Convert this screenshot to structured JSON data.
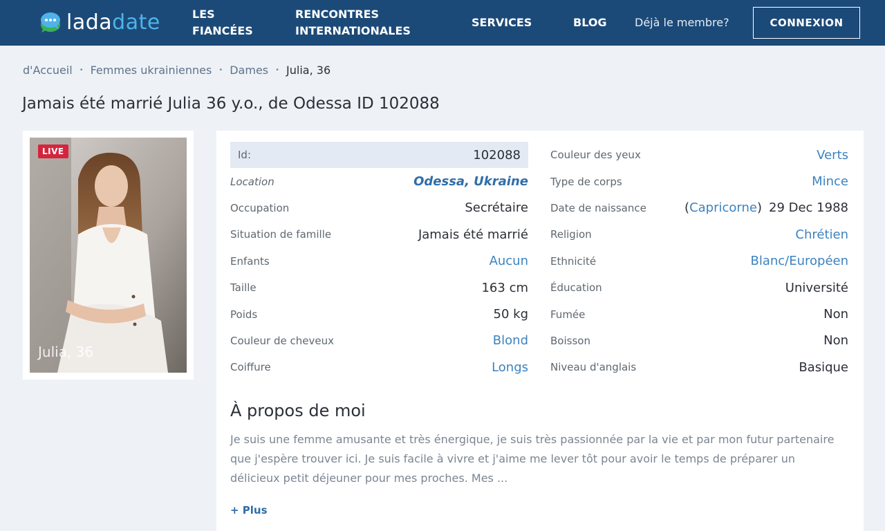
{
  "header": {
    "logo_part1": "lada",
    "logo_part2": "date",
    "nav": [
      {
        "line1": "LES",
        "line2": "FIANCÉES"
      },
      {
        "line1": "RENCONTRES",
        "line2": "INTERNATIONALES"
      },
      {
        "label": "SERVICES"
      },
      {
        "label": "BLOG"
      }
    ],
    "member_text": "Déjà le membre?",
    "connexion_label": "CONNEXION"
  },
  "breadcrumb": {
    "items": [
      "d'Accueil",
      "Femmes ukrainiennes",
      "Dames"
    ],
    "current": "Julia, 36",
    "separator": "•"
  },
  "page_title": "Jamais été marrié Julia 36 y.o., de Odessa ID 102088",
  "photo": {
    "badge": "LIVE",
    "caption": "Julia, 36"
  },
  "details_left": [
    {
      "label": "Id:",
      "value": "102088"
    },
    {
      "label": "Location",
      "value": "Odessa, Ukraine"
    },
    {
      "label": "Occupation",
      "value": "Secrétaire"
    },
    {
      "label": "Situation de famille",
      "value": "Jamais été marrié"
    },
    {
      "label": "Enfants",
      "value": "Aucun"
    },
    {
      "label": "Taille",
      "value": "163 cm"
    },
    {
      "label": "Poids",
      "value": "50 kg"
    },
    {
      "label": "Couleur de cheveux",
      "value": "Blond"
    },
    {
      "label": "Coiffure",
      "value": "Longs"
    }
  ],
  "details_right": [
    {
      "label": "Couleur des yeux",
      "value": "Verts"
    },
    {
      "label": "Type de corps",
      "value": "Mince"
    },
    {
      "label": "Date de naissance",
      "zodiac": "Capricorne",
      "paren_open": "(",
      "paren_close": ")",
      "value": "29 Dec 1988"
    },
    {
      "label": "Religion",
      "value": "Chrétien"
    },
    {
      "label": "Ethnicité",
      "value": "Blanc/Européen"
    },
    {
      "label": "Éducation",
      "value": "Université"
    },
    {
      "label": "Fumée",
      "value": "Non"
    },
    {
      "label": "Boisson",
      "value": "Non"
    },
    {
      "label": "Niveau d'anglais",
      "value": "Basique"
    }
  ],
  "about": {
    "title": "À propos de moi",
    "text": "Je suis une femme amusante et très énergique, je suis très passionnée par la vie et par mon futur partenaire que j'espère trouver ici. Je suis facile à vivre et j'aime me lever tôt pour avoir le temps de préparer un délicieux petit déjeuner pour mes proches. Mes ...",
    "more_label": "+ Plus"
  },
  "colors": {
    "header_bg": "#1c4a78",
    "link": "#3c82bf",
    "live_badge": "#d6243d",
    "logo_accent": "#4fb3ea"
  }
}
